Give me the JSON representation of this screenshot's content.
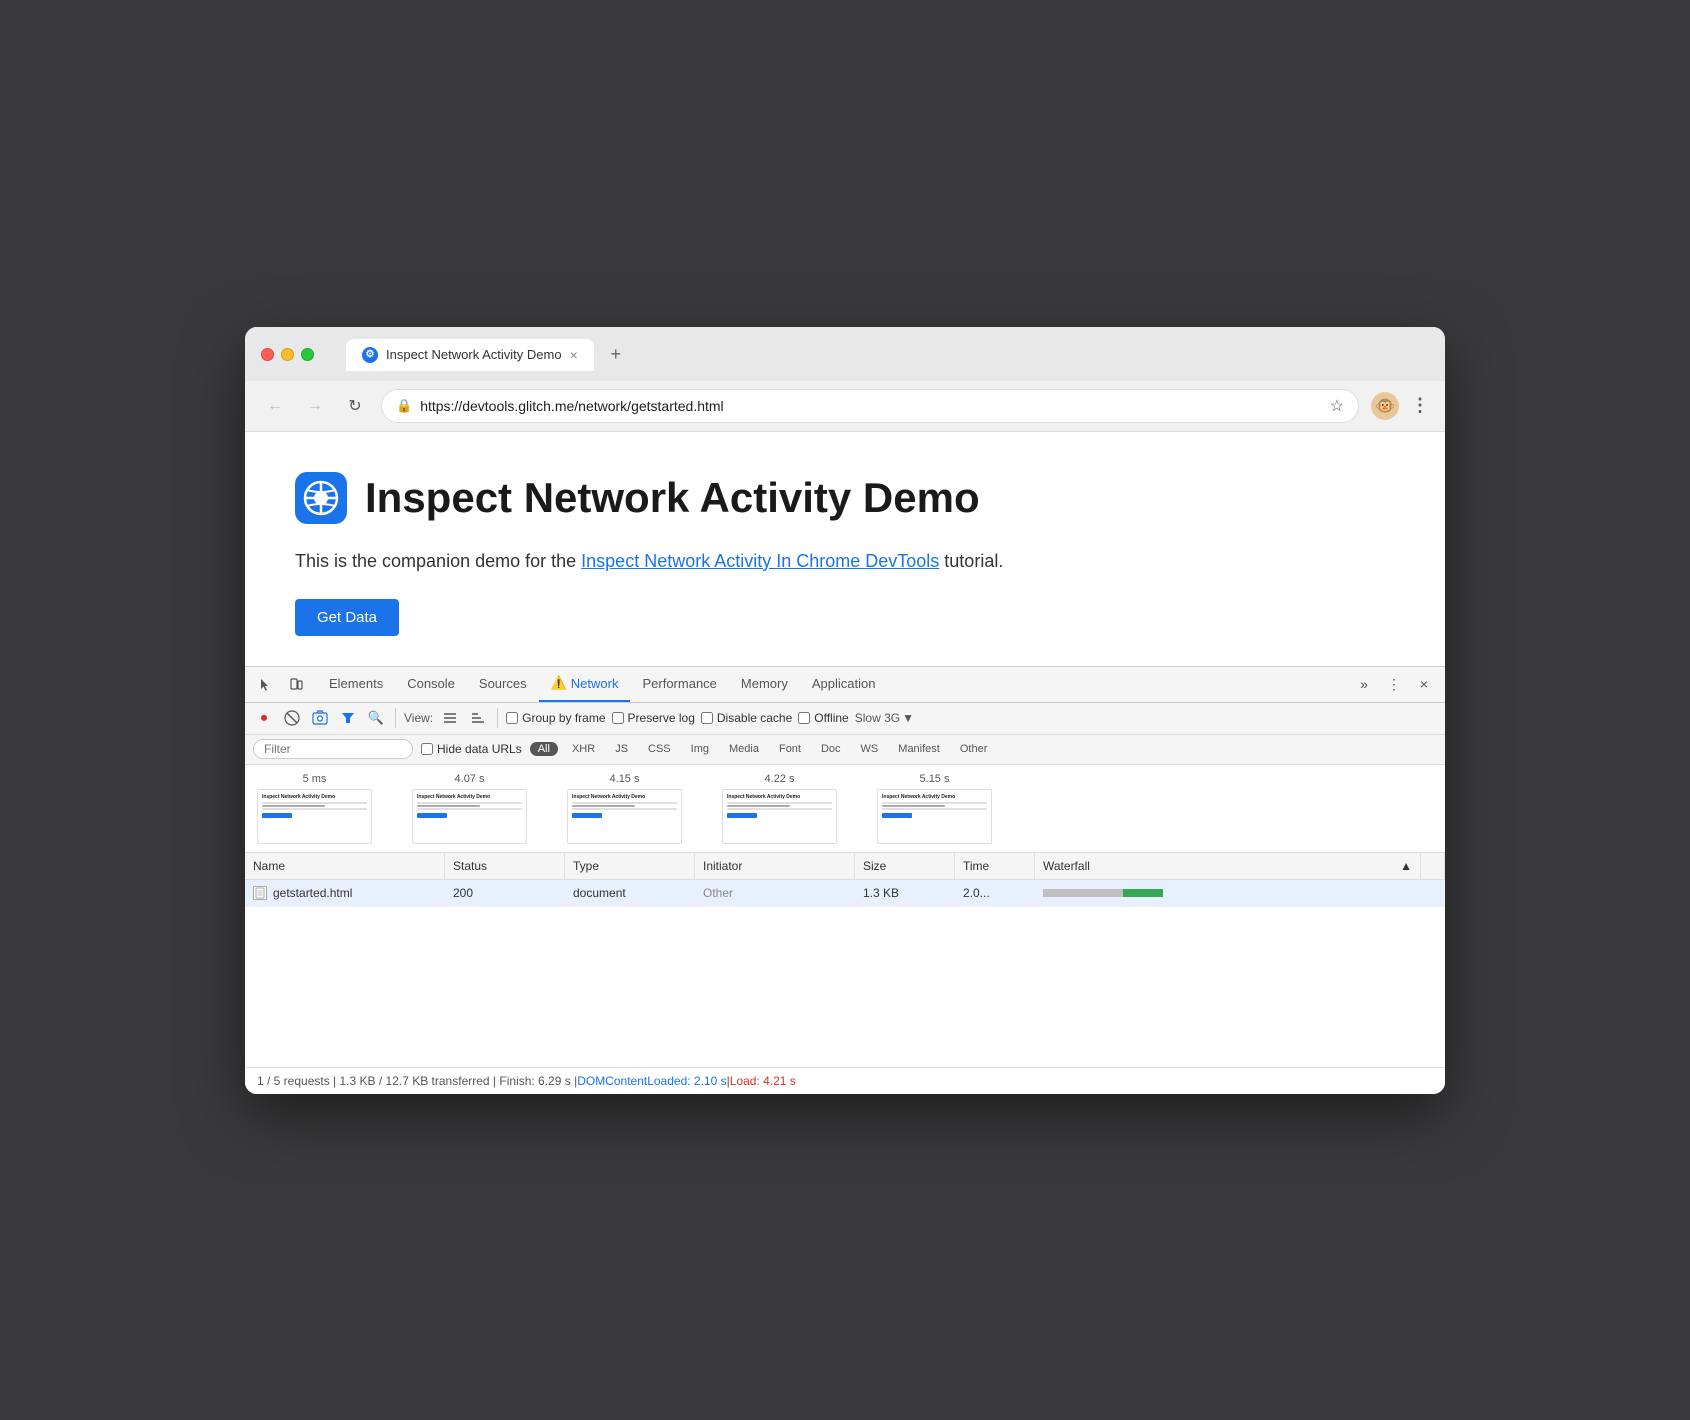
{
  "browser": {
    "tab": {
      "title": "Inspect Network Activity Demo",
      "close_label": "×",
      "new_tab_label": "+"
    },
    "nav": {
      "back_label": "←",
      "forward_label": "→",
      "reload_label": "↻",
      "url": "https://devtools.glitch.me/network/getstarted.html",
      "star_label": "☆",
      "menu_label": "⋮"
    }
  },
  "page": {
    "title": "Inspect Network Activity Demo",
    "description_prefix": "This is the companion demo for the ",
    "link_text": "Inspect Network Activity In Chrome DevTools",
    "description_suffix": " tutorial.",
    "button_label": "Get Data"
  },
  "devtools": {
    "tabs": [
      {
        "label": "Elements",
        "active": false
      },
      {
        "label": "Console",
        "active": false
      },
      {
        "label": "Sources",
        "active": false
      },
      {
        "label": "Network",
        "active": true,
        "has_warning": true
      },
      {
        "label": "Performance",
        "active": false
      },
      {
        "label": "Memory",
        "active": false
      },
      {
        "label": "Application",
        "active": false
      }
    ],
    "more_label": "»",
    "options_label": "⋮",
    "close_label": "×"
  },
  "network_toolbar": {
    "record_icon": "⏺",
    "clear_icon": "🚫",
    "screenshot_icon": "📷",
    "filter_icon": "▼",
    "search_icon": "🔍",
    "view_label": "View:",
    "group_frame_label": "Group by frame",
    "preserve_log_label": "Preserve log",
    "disable_cache_label": "Disable cache",
    "offline_label": "Offline",
    "throttle_label": "Slow 3G",
    "throttle_arrow": "▼"
  },
  "filter_bar": {
    "placeholder": "Filter",
    "hide_data_urls_label": "Hide data URLs",
    "filter_types": [
      "All",
      "XHR",
      "JS",
      "CSS",
      "Img",
      "Media",
      "Font",
      "Doc",
      "WS",
      "Manifest",
      "Other"
    ]
  },
  "timeline": {
    "markers": [
      {
        "time": "5 ms"
      },
      {
        "time": "4.07 s"
      },
      {
        "time": "4.15 s"
      },
      {
        "time": "4.22 s"
      },
      {
        "time": "5.15 s"
      }
    ]
  },
  "table": {
    "headers": [
      {
        "label": "Name"
      },
      {
        "label": "Status"
      },
      {
        "label": "Type"
      },
      {
        "label": "Initiator"
      },
      {
        "label": "Size"
      },
      {
        "label": "Time"
      },
      {
        "label": "Waterfall",
        "sort": "▲"
      }
    ],
    "rows": [
      {
        "name": "getstarted.html",
        "status": "200",
        "type": "document",
        "initiator": "Other",
        "size": "1.3 KB",
        "time": "2.0..."
      }
    ]
  },
  "status_bar": {
    "text": "1 / 5 requests | 1.3 KB / 12.7 KB transferred | Finish: 6.29 s | ",
    "dom_label": "DOMContentLoaded: 2.10 s",
    "separator": " | ",
    "load_label": "Load: 4.21 s"
  }
}
